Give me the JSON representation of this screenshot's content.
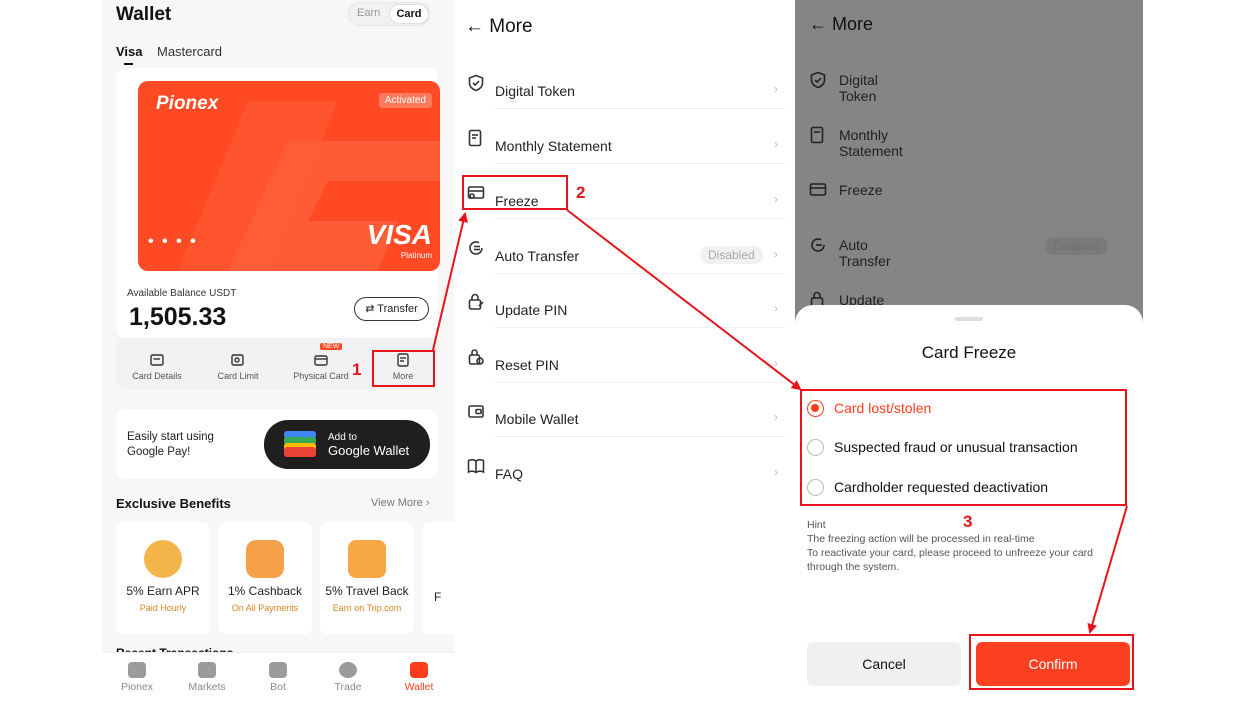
{
  "wallet": {
    "title": "Wallet",
    "toggle": {
      "earn": "Earn",
      "card": "Card"
    },
    "tabs": {
      "visa": "Visa",
      "mastercard": "Mastercard"
    },
    "card": {
      "brand": "Pionex",
      "status": "Activated",
      "dots": "• • • •",
      "network": "VISA",
      "tier": "Platinum"
    },
    "balance": {
      "label": "Available Balance USDT",
      "value": "1,505.33",
      "transfer": "Transfer"
    },
    "actions": [
      {
        "label": "Card Details"
      },
      {
        "label": "Card Limit"
      },
      {
        "label": "Physical Card",
        "badge": "NEW"
      },
      {
        "label": "More"
      }
    ],
    "gpay": {
      "text": "Easily start using Google Pay!",
      "btn_small": "Add to",
      "btn_big": "Google Wallet"
    },
    "benefits": {
      "title": "Exclusive Benefits",
      "view_more": "View More",
      "items": [
        {
          "title": "5% Earn APR",
          "sub": "Paid Hourly"
        },
        {
          "title": "1% Cashback",
          "sub": "On All Payments"
        },
        {
          "title": "5% Travel Back",
          "sub": "Earn on Trip.com"
        },
        {
          "title": "F",
          "sub": ""
        }
      ]
    },
    "recent": "Recent Transactions",
    "tabbar": [
      "Pionex",
      "Markets",
      "Bot",
      "Trade",
      "Wallet"
    ]
  },
  "more": {
    "title": "← More",
    "items": [
      {
        "label": "Digital Token",
        "icon": "shield-check-icon"
      },
      {
        "label": "Monthly Statement",
        "icon": "statement-icon"
      },
      {
        "label": "Freeze",
        "icon": "freeze-card-icon"
      },
      {
        "label": "Auto Transfer",
        "icon": "auto-transfer-icon",
        "status": "Disabled"
      },
      {
        "label": "Update PIN",
        "icon": "update-pin-icon"
      },
      {
        "label": "Reset PIN",
        "icon": "reset-pin-icon"
      },
      {
        "label": "Mobile Wallet",
        "icon": "mobile-wallet-icon"
      },
      {
        "label": "FAQ",
        "icon": "faq-book-icon"
      }
    ],
    "chevron": "›"
  },
  "freeze_sheet": {
    "title": "Card Freeze",
    "options": [
      "Card lost/stolen",
      "Suspected fraud or unusual transaction",
      "Cardholder requested deactivation"
    ],
    "selected_index": 0,
    "hint_title": "Hint",
    "hint_lines": [
      "The freezing action will be processed in real-time",
      "To reactivate your card, please proceed to unfreeze your card",
      "through the system."
    ],
    "cancel": "Cancel",
    "confirm": "Confirm"
  },
  "annotations": {
    "n1": "1",
    "n2": "2",
    "n3": "3"
  },
  "colors": {
    "brand": "#ff4a24",
    "annotation": "#e8141c"
  }
}
